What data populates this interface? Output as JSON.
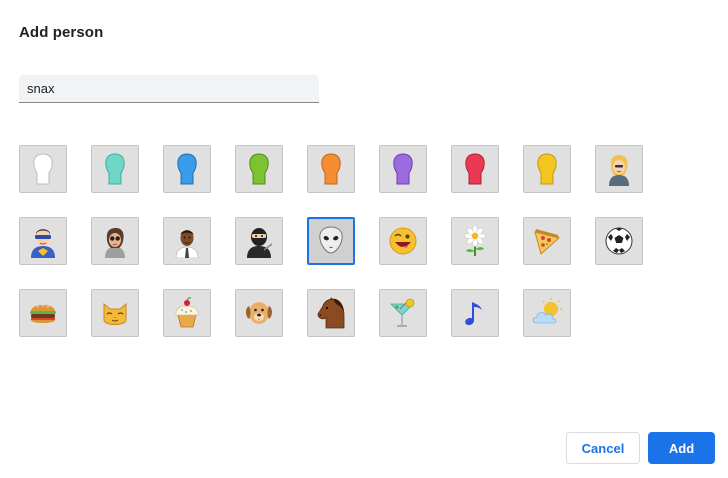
{
  "dialog": {
    "title": "Add person",
    "name_field": {
      "value": "snax",
      "placeholder": ""
    },
    "avatars": [
      {
        "name": "generic-avatar-white-icon",
        "color": "#ffffff"
      },
      {
        "name": "generic-avatar-cyan-icon",
        "color": "#6fd6c8"
      },
      {
        "name": "generic-avatar-blue-icon",
        "color": "#3a9be8"
      },
      {
        "name": "generic-avatar-green-icon",
        "color": "#7cc232"
      },
      {
        "name": "generic-avatar-orange-icon",
        "color": "#f58d31"
      },
      {
        "name": "generic-avatar-purple-icon",
        "color": "#9b6be0"
      },
      {
        "name": "generic-avatar-red-icon",
        "color": "#e83a52"
      },
      {
        "name": "generic-avatar-yellow-icon",
        "color": "#f2c51f"
      },
      {
        "name": "businesswoman-avatar-icon"
      },
      {
        "name": "superhero-avatar-icon"
      },
      {
        "name": "sunglasses-woman-avatar-icon"
      },
      {
        "name": "businessman-avatar-icon"
      },
      {
        "name": "ninja-avatar-icon"
      },
      {
        "name": "alien-avatar-icon",
        "selected": true
      },
      {
        "name": "smiley-avatar-icon"
      },
      {
        "name": "flower-avatar-icon"
      },
      {
        "name": "pizza-avatar-icon"
      },
      {
        "name": "soccer-ball-avatar-icon"
      },
      {
        "name": "burger-avatar-icon"
      },
      {
        "name": "cat-avatar-icon"
      },
      {
        "name": "cupcake-avatar-icon"
      },
      {
        "name": "dog-avatar-icon"
      },
      {
        "name": "horse-avatar-icon"
      },
      {
        "name": "cocktail-avatar-icon"
      },
      {
        "name": "music-note-avatar-icon"
      },
      {
        "name": "sun-cloud-avatar-icon"
      }
    ],
    "buttons": {
      "cancel": "Cancel",
      "add": "Add"
    }
  }
}
